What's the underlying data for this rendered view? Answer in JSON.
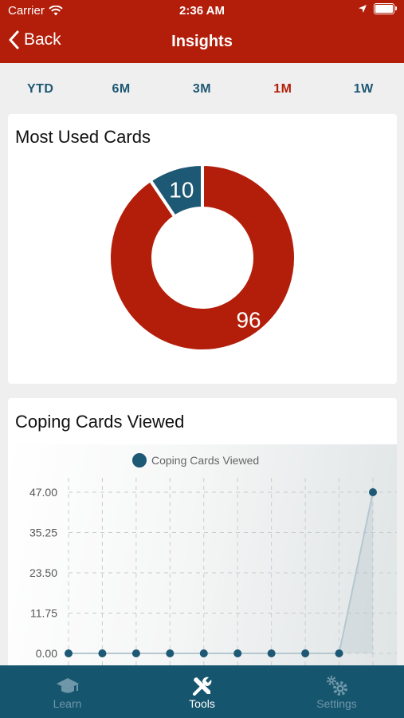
{
  "status_bar": {
    "carrier": "Carrier",
    "time": "2:36 AM"
  },
  "nav": {
    "back_label": "Back",
    "title": "Insights"
  },
  "range_tabs": [
    {
      "label": "YTD",
      "active": false
    },
    {
      "label": "6M",
      "active": false
    },
    {
      "label": "3M",
      "active": false
    },
    {
      "label": "1M",
      "active": true
    },
    {
      "label": "1W",
      "active": false
    }
  ],
  "most_used": {
    "title": "Most Used Cards"
  },
  "coping": {
    "title": "Coping Cards Viewed"
  },
  "colors": {
    "primary": "#b31e0a",
    "accent": "#1d5874",
    "tab_bar": "#16556e"
  },
  "chart_data": [
    {
      "type": "pie",
      "title": "Most Used Cards",
      "donut": true,
      "values": [
        96,
        10
      ],
      "labels": [
        "96",
        "10"
      ],
      "colors": [
        "#b31e0a",
        "#1d5874"
      ]
    },
    {
      "type": "line",
      "title": "Coping Cards Viewed",
      "legend": "top-center",
      "series": [
        {
          "name": "Coping Cards Viewed",
          "values": [
            0,
            0,
            0,
            0,
            0,
            0,
            0,
            0,
            0,
            47
          ]
        }
      ],
      "yticks": [
        "47.00",
        "35.25",
        "23.50",
        "11.75",
        "0.00"
      ],
      "ylim": [
        0,
        47
      ],
      "grid": true,
      "color": "#1d5874"
    }
  ],
  "tabs": [
    {
      "label": "Learn",
      "icon": "graduation-cap-icon",
      "active": false
    },
    {
      "label": "Tools",
      "icon": "tools-icon",
      "active": true
    },
    {
      "label": "Settings",
      "icon": "gears-icon",
      "active": false
    }
  ]
}
